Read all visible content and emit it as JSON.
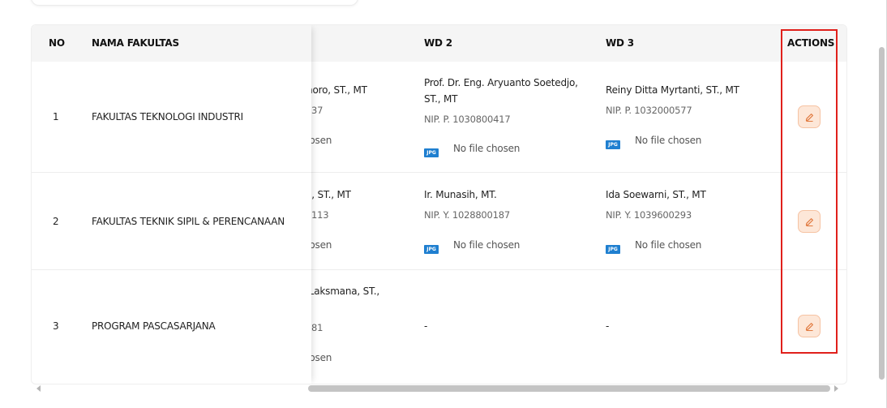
{
  "columns": {
    "no": "NO",
    "nama_fakultas": "NAMA FAKULTAS",
    "wd2": "WD 2",
    "wd3": "WD 3",
    "actions": "ACTIONS"
  },
  "rows": [
    {
      "no": "1",
      "fakultas": "FAKULTAS TEKNOLOGI INDUSTRI",
      "wd1_name_partial": "moro, ST., MT",
      "wd1_nip_partial": "37",
      "wd1_file_partial": "hosen",
      "wd2_name_line1": "Prof. Dr. Eng. Aryuanto Soetedjo,",
      "wd2_name_line2": "ST., MT",
      "wd2_nip": "NIP. P. 1030800417",
      "wd2_file": "No file chosen",
      "wd3_name": "Reiny Ditta Myrtanti, ST., MT",
      "wd3_nip": "NIP. P. 1032000577",
      "wd3_file": "No file chosen"
    },
    {
      "no": "2",
      "fakultas": "FAKULTAS TEKNIK SIPIL & PERENCANAAN",
      "wd1_name_partial": "ai, ST., MT",
      "wd1_nip_partial": "113",
      "wd1_file_partial": "hosen",
      "wd2_name_line1": "Ir. Munasih, MT.",
      "wd2_nip": "NIP. Y. 1028800187",
      "wd2_file": "No file chosen",
      "wd3_name": "Ida Soewarni, ST., MT",
      "wd3_nip": "NIP. Y. 1039600293",
      "wd3_file": "No file chosen"
    },
    {
      "no": "3",
      "fakultas": "PROGRAM PASCASARJANA",
      "wd1_name_partial": "i Laksmana, ST.,",
      "wd1_nip_partial": "81",
      "wd1_file_partial": "hosen",
      "wd2_empty": "-",
      "wd3_empty": "-"
    }
  ],
  "file_badge": "JPG",
  "colors": {
    "highlight": "#e0201b",
    "edit_bg": "#fde7d8",
    "edit_icon": "#e0763a",
    "jpg_badge": "#1f7fd0"
  }
}
